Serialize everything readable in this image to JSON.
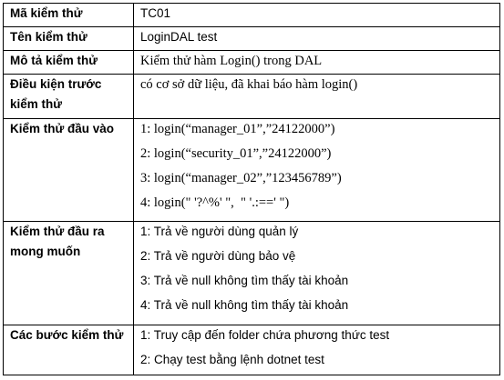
{
  "rows": [
    {
      "label": "Mã kiểm thử",
      "values": [
        "TC01"
      ]
    },
    {
      "label": "Tên kiểm thử",
      "values": [
        "LoginDAL test"
      ]
    },
    {
      "label": "Mô tả kiểm thử",
      "values": [
        "Kiểm thử hàm Login() trong DAL"
      ]
    },
    {
      "label": "Điều kiện trước kiểm thử",
      "values": [
        "có cơ sở dữ liệu, đã khai báo hàm login()"
      ]
    },
    {
      "label": "Kiểm thử đầu vào",
      "values": [
        "1: login(“manager_01”,”24122000”)",
        "2: login(“security_01”,”24122000”)",
        "3: login(“manager_02”,”123456789”)",
        "4: login(\" '?^%' \",  \" '.:==' \")"
      ]
    },
    {
      "label": "Kiểm thử đầu ra mong muốn",
      "values": [
        "1: Trả về người dùng quản lý",
        "2: Trả về người dùng bảo vệ",
        "3: Trả về null không tìm thấy tài khoản",
        "4: Trả về null không tìm thấy tài khoản"
      ]
    },
    {
      "label": "Các bước kiểm thử",
      "values": [
        "1: Truy cập đến folder chứa phương thức test",
        "2: Chạy test bằng lệnh dotnet test"
      ]
    }
  ]
}
